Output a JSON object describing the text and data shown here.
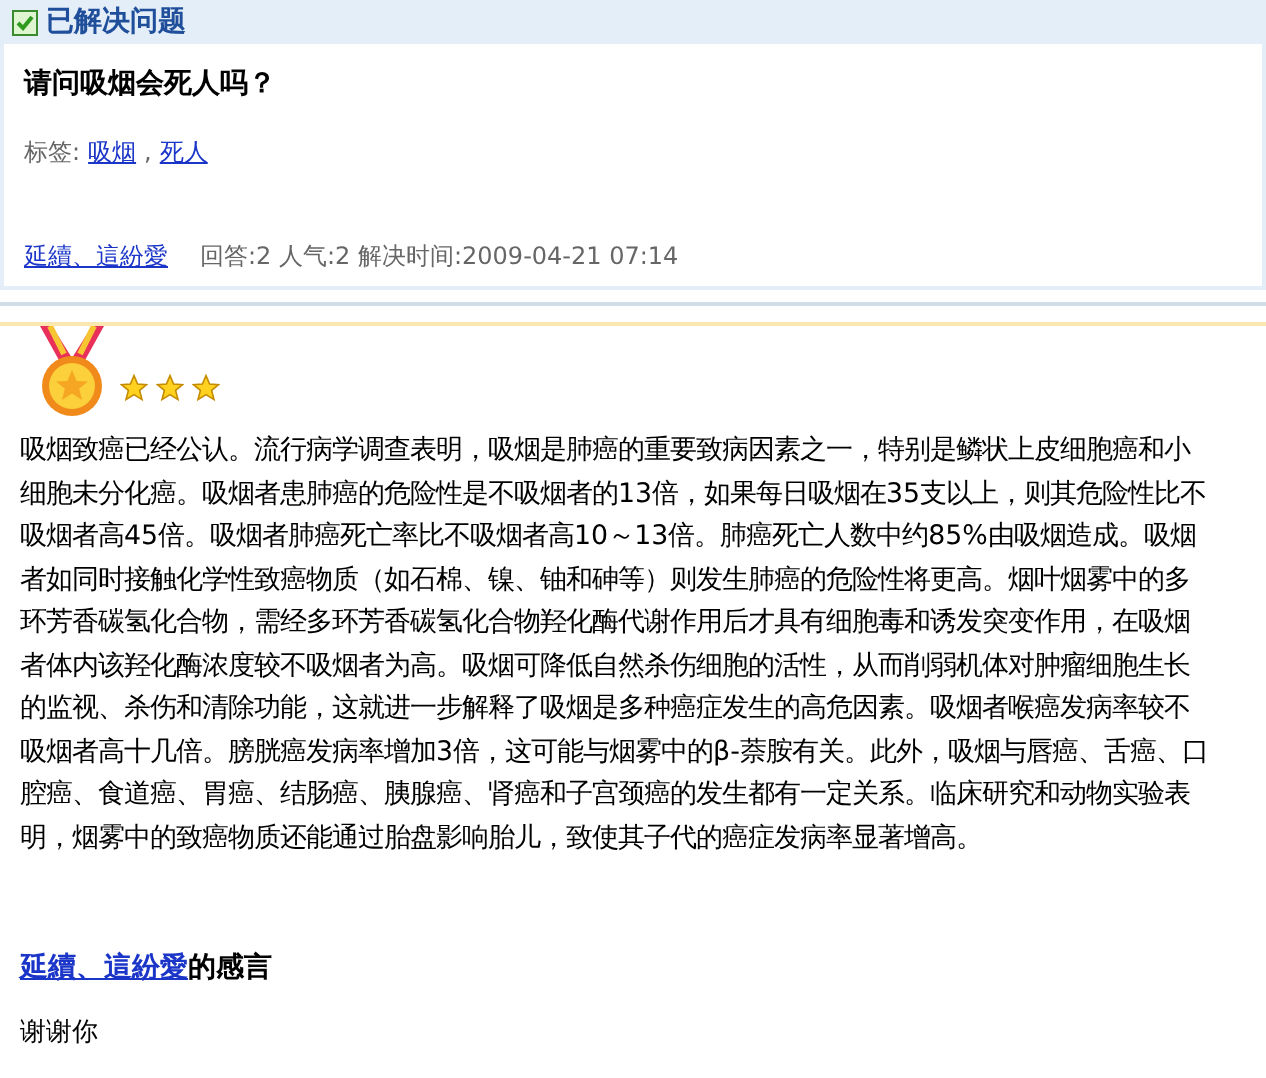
{
  "header": {
    "title": "已解决问题",
    "checked": true
  },
  "question": {
    "title": "请问吸烟会死人吗？",
    "tags_label": "标签:",
    "tags": [
      "吸烟",
      "死人"
    ],
    "tags_separator": ",",
    "author": "延續、這紛愛",
    "meta": "回答:2 人气:2 解决时间:2009-04-21 07:14"
  },
  "answer": {
    "stars": 3,
    "text": "吸烟致癌已经公认。流行病学调查表明，吸烟是肺癌的重要致病因素之一，特别是鳞状上皮细胞癌和小细胞未分化癌。吸烟者患肺癌的危险性是不吸烟者的13倍，如果每日吸烟在35支以上，则其危险性比不吸烟者高45倍。吸烟者肺癌死亡率比不吸烟者高10～13倍。肺癌死亡人数中约85%由吸烟造成。吸烟者如同时接触化学性致癌物质（如石棉、镍、铀和砷等）则发生肺癌的危险性将更高。烟叶烟雾中的多环芳香碳氢化合物，需经多环芳香碳氢化合物羟化酶代谢作用后才具有细胞毒和诱发突变作用，在吸烟者体内该羟化酶浓度较不吸烟者为高。吸烟可降低自然杀伤细胞的活性，从而削弱机体对肿瘤细胞生长的监视、杀伤和清除功能，这就进一步解释了吸烟是多种癌症发生的高危因素。吸烟者喉癌发病率较不吸烟者高十几倍。膀胱癌发病率增加3倍，这可能与烟雾中的β-萘胺有关。此外，吸烟与唇癌、舌癌、口腔癌、食道癌、胃癌、结肠癌、胰腺癌、肾癌和子宫颈癌的发生都有一定关系。临床研究和动物实验表明，烟雾中的致癌物质还能通过胎盘影响胎儿，致使其子代的癌症发病率显著增高。"
  },
  "thanks": {
    "author": "延續、這紛愛",
    "title": "的感言",
    "text": "谢谢你"
  }
}
